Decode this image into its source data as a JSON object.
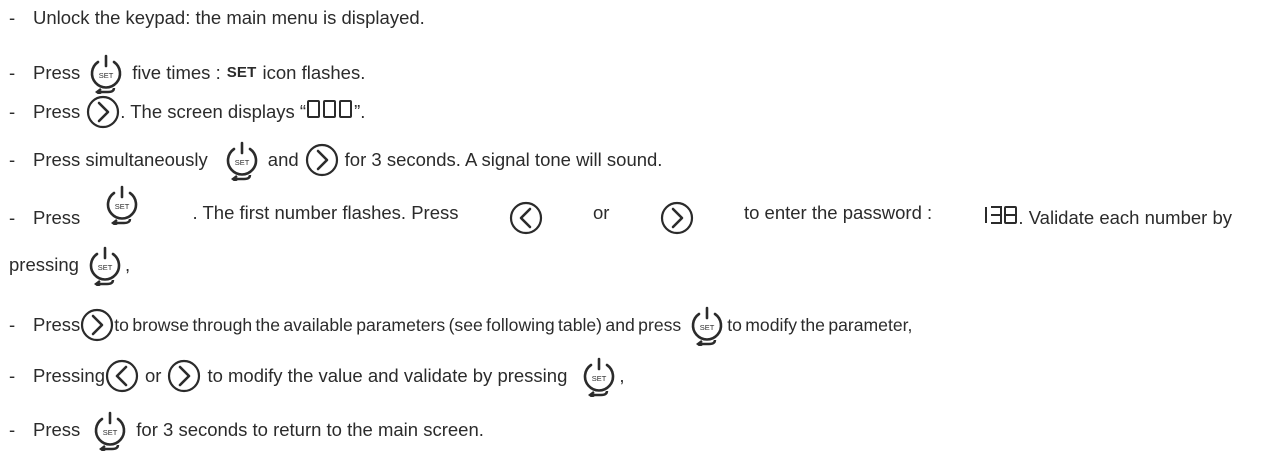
{
  "steps": [
    {
      "prefix": "-",
      "text": "Unlock the keypad: the main menu is displayed."
    },
    {
      "prefix": "-",
      "press": "Press",
      "after_icon": "five times :",
      "bold_label": "SET",
      "tail": "icon flashes."
    },
    {
      "prefix": "-",
      "press": "Press",
      "tail": ". The screen displays “",
      "code": "000",
      "tail2": "”."
    },
    {
      "prefix": "-",
      "press": "Press simultaneously",
      "and": "and",
      "tail": "for 3 seconds. A signal tone will sound."
    },
    {
      "prefix": "-",
      "press": "Press",
      "tail_a": ". The first number flashes. Press",
      "or": "or",
      "tail_b": "to enter the password :",
      "code": "138",
      "tail_c": ". Validate each number by"
    },
    {
      "prefix": "",
      "text": "pressing",
      "tail": ","
    },
    {
      "prefix": "-",
      "press": "Press",
      "tail_a": "to browse through the available parameters (see following table) and press",
      "tail_b": "to modify the parameter,"
    },
    {
      "prefix": "-",
      "press": "Pressing",
      "or": "or",
      "tail_a": "to modify the value and validate by pressing",
      "tail_b": ","
    },
    {
      "prefix": "-",
      "press": "Press",
      "tail": "for 3 seconds to return to the main screen."
    }
  ],
  "icons": {
    "set": "set-power-icon",
    "right": "chevron-right-circle-icon",
    "left": "chevron-left-circle-icon",
    "set_label": "SET"
  },
  "colors": {
    "text": "#2b2b2b"
  }
}
